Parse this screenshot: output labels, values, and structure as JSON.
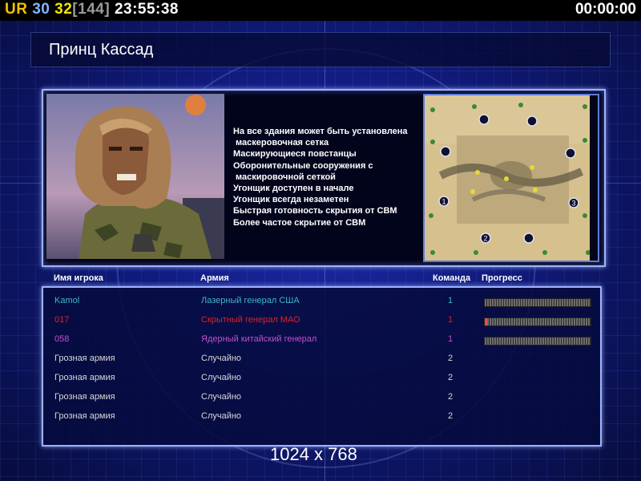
{
  "hud": {
    "ur": "UR",
    "num1": "30",
    "num2": "32",
    "bracket": "[144]",
    "clock": "23:55:38",
    "timer": "00:00:00"
  },
  "title": "Принц Кассад",
  "features": [
    "На все здания может быть установлена",
    " маскеровочная сетка",
    "Маскирующиеся повстанцы",
    "Оборонительные сооружения с",
    " маскировочной сеткой",
    "Угонщик доступен в начале",
    "Угонщик всегда незаметен",
    "Быстрая готовность скрытия от СВМ",
    "Более частое скрытие от СВМ"
  ],
  "map": {
    "start_positions": [
      "1",
      "2",
      "3"
    ]
  },
  "table": {
    "headers": {
      "name": "Имя игрока",
      "army": "Армия",
      "team": "Команда",
      "progress": "Прогресс"
    },
    "rows": [
      {
        "name": "Kamol",
        "army": "Лазерный генерал США",
        "team": "1",
        "color": "#3cb6c8",
        "progress": 0
      },
      {
        "name": "017",
        "army": "Скрытный генерал МАО",
        "team": "1",
        "color": "#e02020",
        "progress": 0.02
      },
      {
        "name": "058",
        "army": "Ядерный китайский генерал",
        "team": "1",
        "color": "#c050d0",
        "progress": 0
      },
      {
        "name": "Грозная армия",
        "army": "Случайно",
        "team": "2",
        "color": "#d8d8d8"
      },
      {
        "name": "Грозная армия",
        "army": "Случайно",
        "team": "2",
        "color": "#d8d8d8"
      },
      {
        "name": "Грозная армия",
        "army": "Случайно",
        "team": "2",
        "color": "#d8d8d8"
      },
      {
        "name": "Грозная армия",
        "army": "Случайно",
        "team": "2",
        "color": "#d8d8d8"
      }
    ]
  },
  "resolution": "1024 x 768"
}
